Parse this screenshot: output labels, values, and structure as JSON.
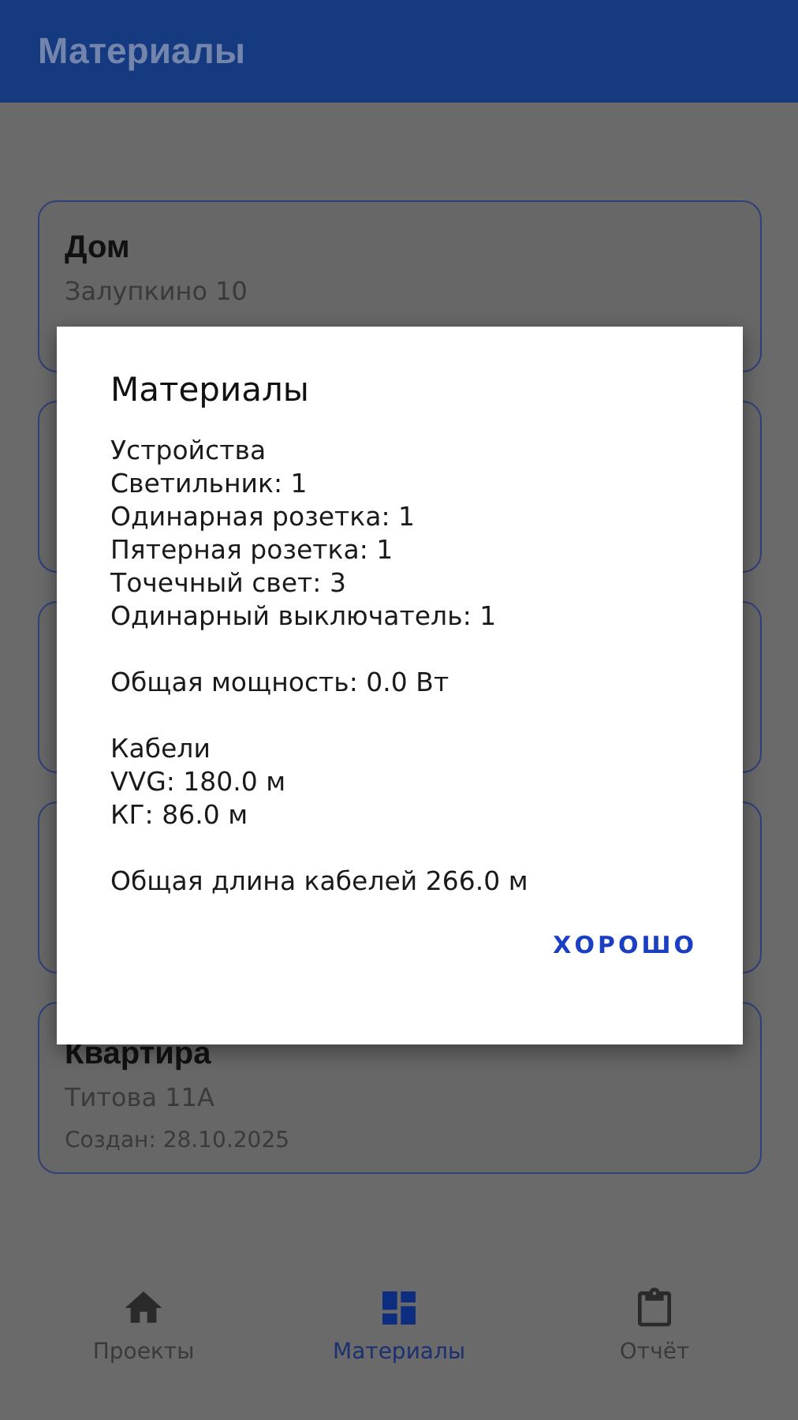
{
  "app_bar": {
    "title": "Материалы"
  },
  "cards": [
    {
      "kind": "project",
      "title": "Дом",
      "address": "Залупкино 10"
    },
    {
      "kind": "covered"
    },
    {
      "kind": "covered"
    },
    {
      "kind": "covered"
    },
    {
      "kind": "project",
      "title": "Квартира",
      "address": "Титова 11А",
      "created": "Создан: 28.10.2025"
    }
  ],
  "dialog": {
    "title": "Материалы",
    "groups": [
      [
        "Устройства",
        "Светильник: 1",
        "Одинарная розетка: 1",
        "Пятерная розетка: 1",
        "Точечный свет: 3",
        "Одинарный выключатель: 1"
      ],
      [
        "Общая мощность: 0.0 Вт"
      ],
      [
        "Кабели",
        "VVG: 180.0 м",
        "КГ: 86.0 м"
      ],
      [
        "Общая длина кабелей 266.0 м"
      ]
    ],
    "button": "ХОРОШО"
  },
  "bottom_nav": [
    {
      "kind": "home",
      "label": "Проекты",
      "selected": false
    },
    {
      "kind": "grid",
      "label": "Материалы",
      "selected": true
    },
    {
      "kind": "clipboard",
      "label": "Отчёт",
      "selected": false
    }
  ]
}
